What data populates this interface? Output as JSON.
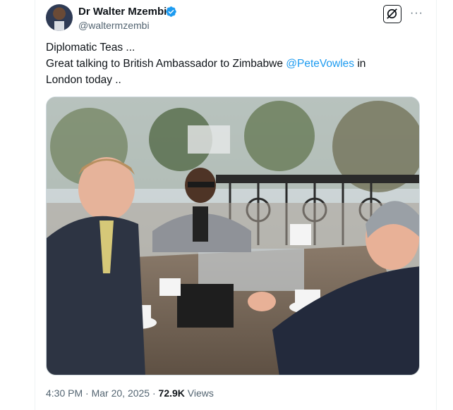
{
  "author": {
    "display_name": "Dr Walter Mzembi",
    "handle": "@waltermzembi",
    "verified": true,
    "avatar_icon": "avatar-photo",
    "verified_icon": "verified-badge-icon",
    "verified_color": "#1d9bf0"
  },
  "actions": {
    "grok_icon": "grok-icon",
    "more_icon": "more-horizontal-icon",
    "more_label": "···"
  },
  "tweet": {
    "line1": "Diplomatic Teas ...",
    "line2_prefix": "Great talking to British Ambassador to Zimbabwe ",
    "mention": "@PeteVowles",
    "line2_suffix": " in",
    "line3": "London today ..",
    "mention_color": "#1d9bf0"
  },
  "media": {
    "type": "photo"
  },
  "meta": {
    "time": "4:30 PM",
    "separator": " · ",
    "date": "Mar 20, 2025",
    "views_count": "72.9K",
    "views_label": " Views"
  }
}
